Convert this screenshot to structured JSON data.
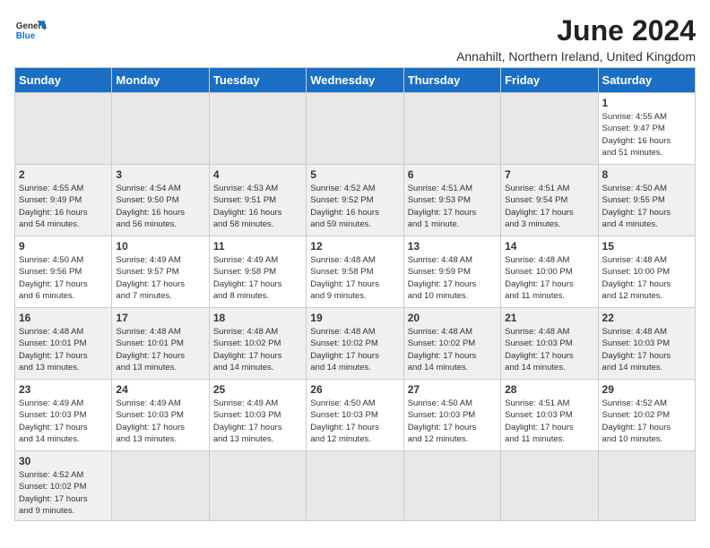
{
  "header": {
    "logo_general": "General",
    "logo_blue": "Blue",
    "title": "June 2024",
    "subtitle": "Annahilt, Northern Ireland, United Kingdom"
  },
  "days_of_week": [
    "Sunday",
    "Monday",
    "Tuesday",
    "Wednesday",
    "Thursday",
    "Friday",
    "Saturday"
  ],
  "weeks": [
    {
      "cells": [
        {
          "day": "",
          "info": ""
        },
        {
          "day": "",
          "info": ""
        },
        {
          "day": "",
          "info": ""
        },
        {
          "day": "",
          "info": ""
        },
        {
          "day": "",
          "info": ""
        },
        {
          "day": "",
          "info": ""
        },
        {
          "day": "1",
          "info": "Sunrise: 4:55 AM\nSunset: 9:47 PM\nDaylight: 16 hours\nand 51 minutes."
        }
      ]
    },
    {
      "cells": [
        {
          "day": "2",
          "info": "Sunrise: 4:55 AM\nSunset: 9:49 PM\nDaylight: 16 hours\nand 54 minutes."
        },
        {
          "day": "3",
          "info": "Sunrise: 4:54 AM\nSunset: 9:50 PM\nDaylight: 16 hours\nand 56 minutes."
        },
        {
          "day": "4",
          "info": "Sunrise: 4:53 AM\nSunset: 9:51 PM\nDaylight: 16 hours\nand 58 minutes."
        },
        {
          "day": "5",
          "info": "Sunrise: 4:52 AM\nSunset: 9:52 PM\nDaylight: 16 hours\nand 59 minutes."
        },
        {
          "day": "6",
          "info": "Sunrise: 4:51 AM\nSunset: 9:53 PM\nDaylight: 17 hours\nand 1 minute."
        },
        {
          "day": "7",
          "info": "Sunrise: 4:51 AM\nSunset: 9:54 PM\nDaylight: 17 hours\nand 3 minutes."
        },
        {
          "day": "8",
          "info": "Sunrise: 4:50 AM\nSunset: 9:55 PM\nDaylight: 17 hours\nand 4 minutes."
        }
      ]
    },
    {
      "cells": [
        {
          "day": "9",
          "info": "Sunrise: 4:50 AM\nSunset: 9:56 PM\nDaylight: 17 hours\nand 6 minutes."
        },
        {
          "day": "10",
          "info": "Sunrise: 4:49 AM\nSunset: 9:57 PM\nDaylight: 17 hours\nand 7 minutes."
        },
        {
          "day": "11",
          "info": "Sunrise: 4:49 AM\nSunset: 9:58 PM\nDaylight: 17 hours\nand 8 minutes."
        },
        {
          "day": "12",
          "info": "Sunrise: 4:48 AM\nSunset: 9:58 PM\nDaylight: 17 hours\nand 9 minutes."
        },
        {
          "day": "13",
          "info": "Sunrise: 4:48 AM\nSunset: 9:59 PM\nDaylight: 17 hours\nand 10 minutes."
        },
        {
          "day": "14",
          "info": "Sunrise: 4:48 AM\nSunset: 10:00 PM\nDaylight: 17 hours\nand 11 minutes."
        },
        {
          "day": "15",
          "info": "Sunrise: 4:48 AM\nSunset: 10:00 PM\nDaylight: 17 hours\nand 12 minutes."
        }
      ]
    },
    {
      "cells": [
        {
          "day": "16",
          "info": "Sunrise: 4:48 AM\nSunset: 10:01 PM\nDaylight: 17 hours\nand 13 minutes."
        },
        {
          "day": "17",
          "info": "Sunrise: 4:48 AM\nSunset: 10:01 PM\nDaylight: 17 hours\nand 13 minutes."
        },
        {
          "day": "18",
          "info": "Sunrise: 4:48 AM\nSunset: 10:02 PM\nDaylight: 17 hours\nand 14 minutes."
        },
        {
          "day": "19",
          "info": "Sunrise: 4:48 AM\nSunset: 10:02 PM\nDaylight: 17 hours\nand 14 minutes."
        },
        {
          "day": "20",
          "info": "Sunrise: 4:48 AM\nSunset: 10:02 PM\nDaylight: 17 hours\nand 14 minutes."
        },
        {
          "day": "21",
          "info": "Sunrise: 4:48 AM\nSunset: 10:03 PM\nDaylight: 17 hours\nand 14 minutes."
        },
        {
          "day": "22",
          "info": "Sunrise: 4:48 AM\nSunset: 10:03 PM\nDaylight: 17 hours\nand 14 minutes."
        }
      ]
    },
    {
      "cells": [
        {
          "day": "23",
          "info": "Sunrise: 4:49 AM\nSunset: 10:03 PM\nDaylight: 17 hours\nand 14 minutes."
        },
        {
          "day": "24",
          "info": "Sunrise: 4:49 AM\nSunset: 10:03 PM\nDaylight: 17 hours\nand 13 minutes."
        },
        {
          "day": "25",
          "info": "Sunrise: 4:49 AM\nSunset: 10:03 PM\nDaylight: 17 hours\nand 13 minutes."
        },
        {
          "day": "26",
          "info": "Sunrise: 4:50 AM\nSunset: 10:03 PM\nDaylight: 17 hours\nand 12 minutes."
        },
        {
          "day": "27",
          "info": "Sunrise: 4:50 AM\nSunset: 10:03 PM\nDaylight: 17 hours\nand 12 minutes."
        },
        {
          "day": "28",
          "info": "Sunrise: 4:51 AM\nSunset: 10:03 PM\nDaylight: 17 hours\nand 11 minutes."
        },
        {
          "day": "29",
          "info": "Sunrise: 4:52 AM\nSunset: 10:02 PM\nDaylight: 17 hours\nand 10 minutes."
        }
      ]
    },
    {
      "cells": [
        {
          "day": "30",
          "info": "Sunrise: 4:52 AM\nSunset: 10:02 PM\nDaylight: 17 hours\nand 9 minutes."
        },
        {
          "day": "",
          "info": ""
        },
        {
          "day": "",
          "info": ""
        },
        {
          "day": "",
          "info": ""
        },
        {
          "day": "",
          "info": ""
        },
        {
          "day": "",
          "info": ""
        },
        {
          "day": "",
          "info": ""
        }
      ]
    }
  ]
}
